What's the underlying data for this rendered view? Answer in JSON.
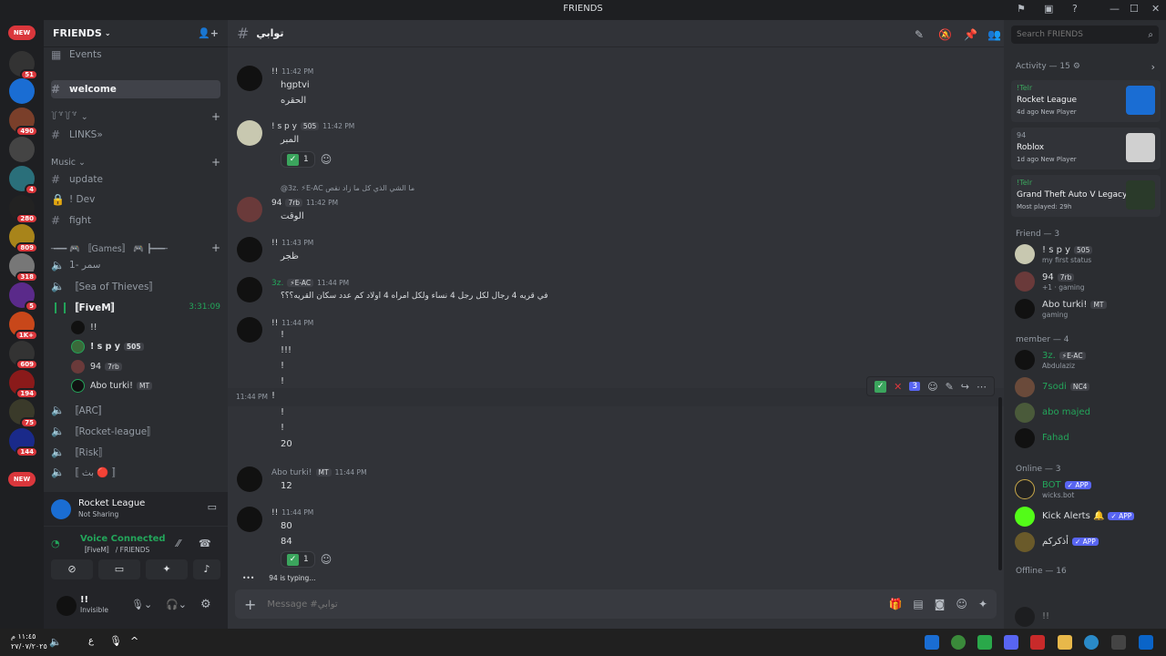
{
  "window": {
    "title": "FRIENDS"
  },
  "server_badges": {
    "new_top": "NEW",
    "b1": "51",
    "b2": "490",
    "b3": "4",
    "b4": "280",
    "b5": "809",
    "b6": "318",
    "b7": "5",
    "b8": "1K+",
    "b9": "609",
    "b10": "194",
    "b11": "75",
    "b12": "144",
    "new_bottom": "NEW"
  },
  "sidebar": {
    "server_name": "FRIENDS",
    "events": "Events",
    "welcome": "welcome",
    "cat_divider": "꒦꒷꒦꒷ ⌄",
    "links": "LINKS»",
    "music_cat": "Music",
    "update": "update",
    "dev": "! Dev",
    "fight": "fight",
    "games_cat": "╼━━ 🎮 〚Games〛 🎮 ┣━━╾",
    "v1": "سمر -1",
    "v2": "〚Sea of Thieves〛",
    "v3": "〚FiveM〛",
    "v3_timer": "3:31:09",
    "vusers": [
      {
        "name": "!!",
        "chip": ""
      },
      {
        "name": "! s p y",
        "chip": "505"
      },
      {
        "name": "94",
        "chip": "7rb"
      },
      {
        "name": "Abo turki!",
        "chip": "MT"
      }
    ],
    "v4": "〚ARC〛",
    "v5": "〚Rocket-league〛",
    "v6": "〚Risk〛",
    "v7": "〚 بث 🔴 〛"
  },
  "activity_box": {
    "game": "Rocket League",
    "status": "Not Sharing"
  },
  "voice_box": {
    "title": "Voice Connected",
    "channel": "〚FiveM〛 / FRIENDS"
  },
  "user_panel": {
    "name": "!!",
    "status": "Invisible"
  },
  "channel": {
    "name": "توابي",
    "placeholder": "Message #توابي"
  },
  "messages": [
    {
      "author": "!!",
      "time": "11:42 PM",
      "lines": [
        "hgptvi",
        "الحقره"
      ]
    },
    {
      "author": "! s p y",
      "chip": "505",
      "time": "11:42 PM",
      "lines": [
        "المبر"
      ],
      "reaction": "1"
    },
    {
      "reply": "@3z. ⚡E-AC ما الشي الذي كل ما زاد نقص",
      "author": "94",
      "chip": "7rb",
      "time": "11:42 PM",
      "lines": [
        "الوقت"
      ]
    },
    {
      "author": "!!",
      "time": "11:43 PM",
      "lines": [
        "ظجر"
      ]
    },
    {
      "author": "3z.",
      "chip": "⚡E-AC",
      "time": "11:44 PM",
      "lines": [
        "في قريه 4 رجال      لكل رجل 4 نساء      ولكل امراه 4 اولاد      كم عدد سكان القريه؟؟؟"
      ]
    },
    {
      "author": "!!",
      "time": "11:44 PM",
      "lines": [
        "!",
        "!!!",
        "!",
        "!",
        "!",
        "!",
        "!",
        "20"
      ],
      "hover_time": "11:44 PM",
      "hover_react": "3"
    },
    {
      "author": "Abo turki!",
      "chip": "MT",
      "time": "11:44 PM",
      "lines": [
        "12"
      ]
    },
    {
      "author": "!!",
      "time": "11:44 PM",
      "lines": [
        "80",
        "84"
      ],
      "reaction": "1"
    }
  ],
  "typing": "94 is typing...",
  "search": {
    "placeholder": "Search FRIENDS"
  },
  "members": {
    "activity_header": "Activity — 15",
    "activities": [
      {
        "user": "!Telr",
        "game": "Rocket League",
        "sub": "4d ago  New Player"
      },
      {
        "user": "94",
        "game": "Roblox",
        "sub": "1d ago  New Player"
      },
      {
        "user": "!Telr",
        "game": "Grand Theft Auto V Legacy",
        "sub": "Most played: 29h"
      }
    ],
    "friend_header": "Friend — 3",
    "friends": [
      {
        "name": "! s p y",
        "chip": "505",
        "status": "my first status"
      },
      {
        "name": "94",
        "chip": "7rb",
        "status": "+1 · gaming"
      },
      {
        "name": "Abo turki!",
        "chip": "MT",
        "status": "gaming"
      }
    ],
    "member_header": "member — 4",
    "member_list": [
      {
        "name": "3z.",
        "chip": "⚡E-AC",
        "status": "Abdulaziz"
      },
      {
        "name": "7sodi",
        "chip": "NC4",
        "status": ""
      },
      {
        "name": "abo majed",
        "chip": "",
        "status": ""
      },
      {
        "name": "Fahad",
        "chip": "",
        "status": ""
      }
    ],
    "online_header": "Online — 3",
    "online": [
      {
        "name": "BOT",
        "chip": "✓ APP",
        "status": "wicks.bot"
      },
      {
        "name": "Kick Alerts 🔔",
        "chip": "✓ APP",
        "status": ""
      },
      {
        "name": "أذكركم",
        "chip": "✓ APP",
        "status": ""
      }
    ],
    "offline_header": "Offline — 16",
    "offline": [
      {
        "name": "!!"
      }
    ]
  },
  "taskbar": {
    "time": "١١:٤٥ م",
    "date": "٢٧/٠٧/٢٠٢٥",
    "lang": "ع"
  }
}
